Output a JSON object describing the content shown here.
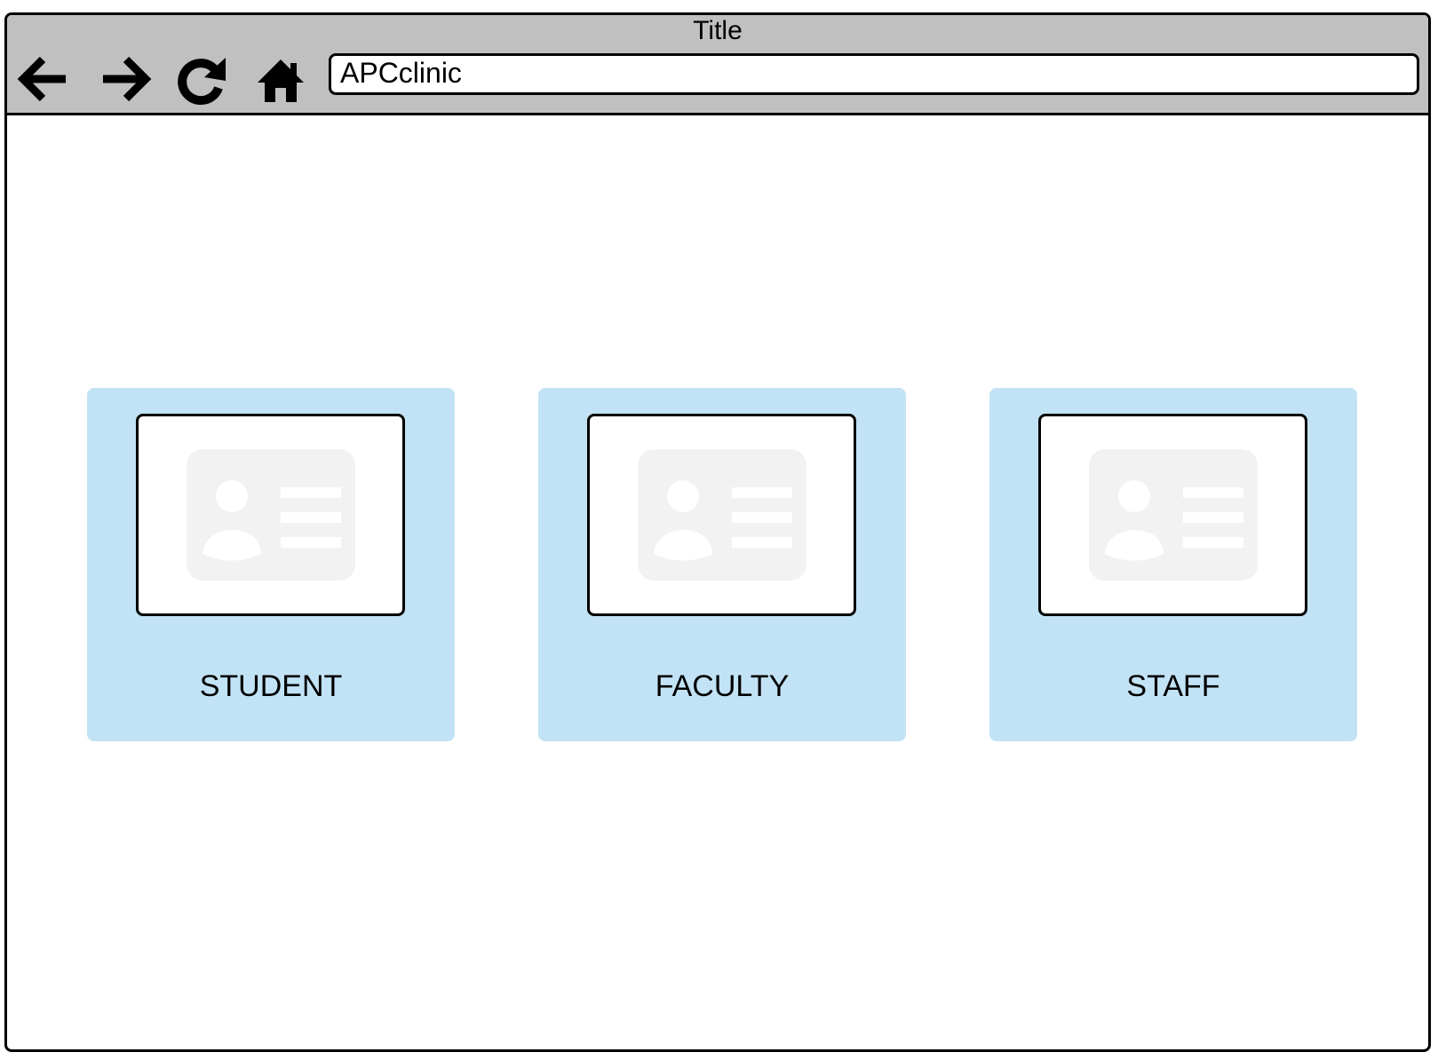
{
  "window": {
    "title": "Title"
  },
  "toolbar": {
    "back_icon": "arrow-left-icon",
    "forward_icon": "arrow-right-icon",
    "reload_icon": "reload-icon",
    "home_icon": "home-icon",
    "url": "APCclinic"
  },
  "cards": [
    {
      "label": "STUDENT",
      "icon": "id-card-icon"
    },
    {
      "label": "FACULTY",
      "icon": "id-card-icon"
    },
    {
      "label": "STAFF",
      "icon": "id-card-icon"
    }
  ],
  "colors": {
    "title_bar": "#c0c0c0",
    "card_background": "#c2e3f5",
    "placeholder_icon": "#f2f2f2"
  }
}
